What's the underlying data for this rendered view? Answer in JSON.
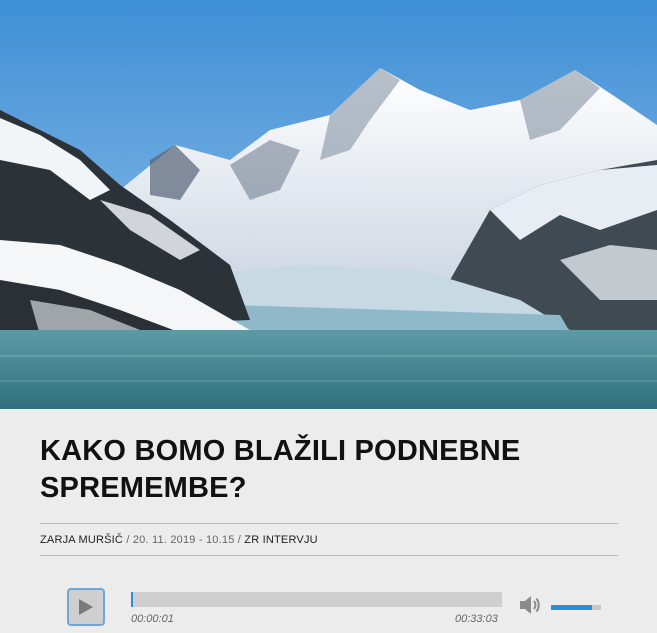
{
  "hero": {
    "image_name": "glacier-mountains-image"
  },
  "article": {
    "title": "KAKO BOMO BLAŽILI PODNEBNE SPREMEMBE?",
    "author": "ZARJA MURŠIČ",
    "separator1": " / ",
    "date": "20. 11. 2019 - 10.15",
    "separator2": " / ",
    "show": "ZR INTERVJU"
  },
  "player": {
    "play_icon": "play-icon",
    "current_time": "00:00:01",
    "duration": "00:33:03",
    "progress_fraction": 0.0005,
    "volume_icon": "speaker-icon",
    "volume_fraction": 0.82,
    "accent_color": "#2a8fd8"
  }
}
